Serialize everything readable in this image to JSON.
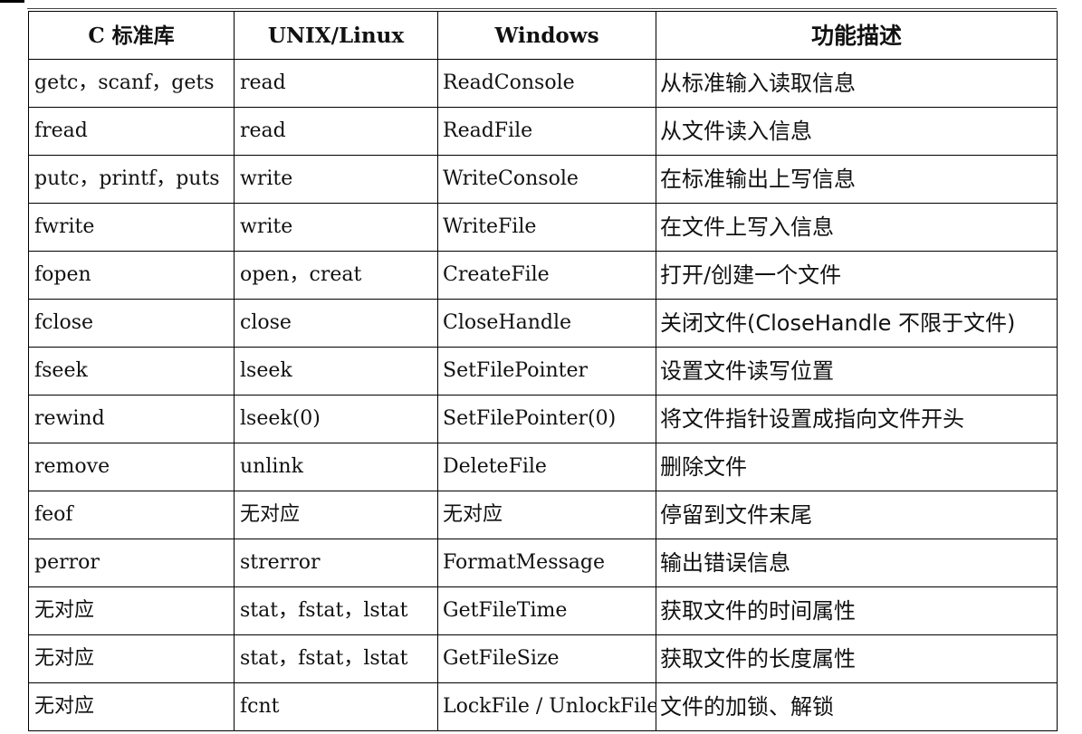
{
  "table": {
    "headers": [
      "C 标准库",
      "UNIX/Linux",
      "Windows",
      "功能描述"
    ],
    "rows": [
      [
        "getc，scanf，gets",
        "read",
        "ReadConsole",
        "从标准输入读取信息"
      ],
      [
        "fread",
        "read",
        "ReadFile",
        "从文件读入信息"
      ],
      [
        "putc，printf，puts",
        "write",
        "WriteConsole",
        "在标准输出上写信息"
      ],
      [
        "fwrite",
        "write",
        "WriteFile",
        "在文件上写入信息"
      ],
      [
        "fopen",
        "open，creat",
        "CreateFile",
        "打开/创建一个文件"
      ],
      [
        "fclose",
        "close",
        "CloseHandle",
        "关闭文件(CloseHandle 不限于文件)"
      ],
      [
        "fseek",
        "lseek",
        "SetFilePointer",
        "设置文件读写位置"
      ],
      [
        "rewind",
        "lseek(0)",
        "SetFilePointer(0)",
        "将文件指针设置成指向文件开头"
      ],
      [
        "remove",
        "unlink",
        "DeleteFile",
        "删除文件"
      ],
      [
        "feof",
        "无对应",
        "无对应",
        "停留到文件末尾"
      ],
      [
        "perror",
        "strerror",
        "FormatMessage",
        "输出错误信息"
      ],
      [
        "无对应",
        "stat，fstat，lstat",
        "GetFileTime",
        "获取文件的时间属性"
      ],
      [
        "无对应",
        "stat，fstat，lstat",
        "GetFileSize",
        "获取文件的长度属性"
      ],
      [
        "无对应",
        "fcnt",
        "LockFile / UnlockFile",
        "文件的加锁、解锁"
      ]
    ]
  }
}
